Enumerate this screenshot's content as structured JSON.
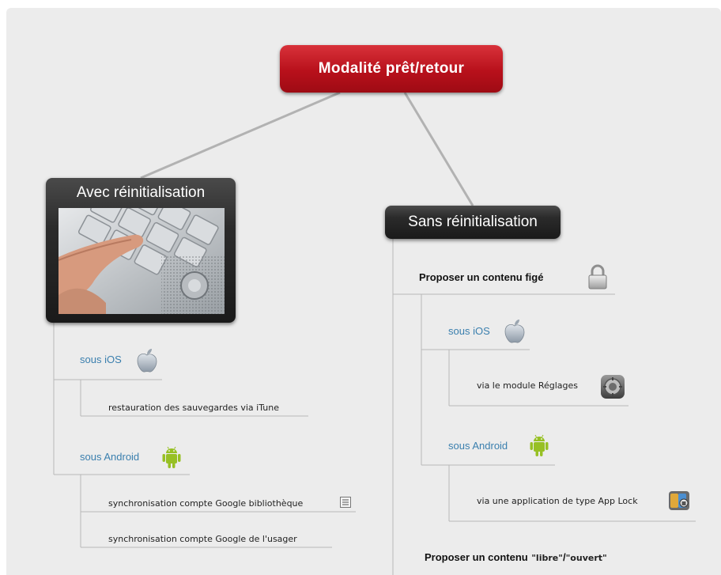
{
  "root": {
    "label": "Modalité prêt/retour"
  },
  "left": {
    "title": "Avec réinitialisation",
    "ios": {
      "label": "sous iOS",
      "icon": "apple-icon",
      "child": "restauration des sauvegardes via iTune"
    },
    "android": {
      "label": "sous Android",
      "icon": "android-icon",
      "children": [
        "synchronisation compte Google bibliothèque",
        "synchronisation compte Google de l'usager"
      ],
      "note_icon": "note-icon"
    }
  },
  "right": {
    "title": "Sans réinitialisation",
    "fixed": {
      "label": "Proposer un contenu figé",
      "icon": "padlock-icon",
      "ios": {
        "label": "sous iOS",
        "icon": "apple-icon",
        "child": "via le module Réglages",
        "child_icon": "settings-icon"
      },
      "android": {
        "label": "sous Android",
        "icon": "android-icon",
        "child": "via une application de type App Lock",
        "child_icon": "app-lock-icon"
      }
    },
    "open": {
      "label_prefix": "Proposer un contenu",
      "q1": "\"libre\"",
      "sep": "/",
      "q2": "\"ouvert\""
    }
  },
  "colors": {
    "root": "#b8101b",
    "dark_node": "#2b2b2b",
    "link_blue": "#3a7fae",
    "connector": "#a9a9a9",
    "android_green": "#97c024"
  }
}
